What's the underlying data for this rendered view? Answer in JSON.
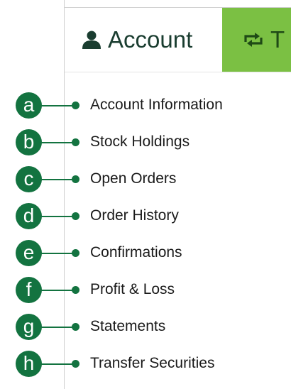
{
  "tabs": {
    "account": {
      "label": "Account",
      "icon": "user-icon"
    },
    "trade": {
      "label": "T",
      "icon": "swap-arrows-icon",
      "color": "#7bc043"
    }
  },
  "colors": {
    "accent": "#137340",
    "tab_active_bg": "#ffffff",
    "tab_trade_bg": "#7bc043"
  },
  "menu": {
    "items": [
      {
        "badge": "a",
        "label": "Account Information"
      },
      {
        "badge": "b",
        "label": "Stock Holdings"
      },
      {
        "badge": "c",
        "label": "Open Orders"
      },
      {
        "badge": "d",
        "label": "Order History"
      },
      {
        "badge": "e",
        "label": "Confirmations"
      },
      {
        "badge": "f",
        "label": "Profit & Loss"
      },
      {
        "badge": "g",
        "label": "Statements"
      },
      {
        "badge": "h",
        "label": "Transfer Securities"
      }
    ]
  }
}
